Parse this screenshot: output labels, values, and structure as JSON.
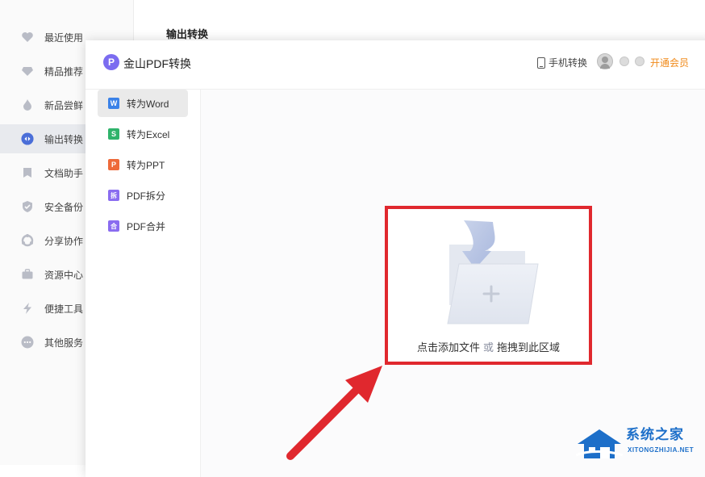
{
  "background_app": {
    "heading": "输出转换",
    "sidebar": [
      {
        "label": "最近使用",
        "icon": "heart-icon"
      },
      {
        "label": "精品推荐",
        "icon": "diamond-icon"
      },
      {
        "label": "新品尝鲜",
        "icon": "flame-icon"
      },
      {
        "label": "输出转换",
        "icon": "convert-icon",
        "active": true
      },
      {
        "label": "文档助手",
        "icon": "bookmark-icon"
      },
      {
        "label": "安全备份",
        "icon": "shield-icon"
      },
      {
        "label": "分享协作",
        "icon": "share-icon"
      },
      {
        "label": "资源中心",
        "icon": "briefcase-icon"
      },
      {
        "label": "便捷工具",
        "icon": "lightning-icon"
      },
      {
        "label": "其他服务",
        "icon": "more-icon"
      }
    ]
  },
  "dialog": {
    "logo_letter": "P",
    "title": "金山PDF转换",
    "header": {
      "phone_convert": "手机转换",
      "vip": "开通会员"
    },
    "menu": [
      {
        "label": "转为Word",
        "icon_letter": "W",
        "icon": "word-icon",
        "color": "#3b82e8",
        "active": true
      },
      {
        "label": "转为Excel",
        "icon_letter": "S",
        "icon": "excel-icon",
        "color": "#2fb36b"
      },
      {
        "label": "转为PPT",
        "icon_letter": "P",
        "icon": "ppt-icon",
        "color": "#ee6a3a"
      },
      {
        "label": "PDF拆分",
        "icon_letter": "拆",
        "icon": "split-icon",
        "color": "#8a6cf0"
      },
      {
        "label": "PDF合并",
        "icon_letter": "合",
        "icon": "merge-icon",
        "color": "#8a6cf0"
      }
    ],
    "drop_zone": {
      "text_click": "点击添加文件",
      "text_or": "或",
      "text_drag": "拖拽到此区域"
    }
  },
  "watermark": {
    "title": "系统之家",
    "url": "XITONGZHIJIA.NET"
  },
  "colors": {
    "highlight_border": "#e0282e",
    "vip": "#f08a1a",
    "logo": "#7b6cf0"
  }
}
